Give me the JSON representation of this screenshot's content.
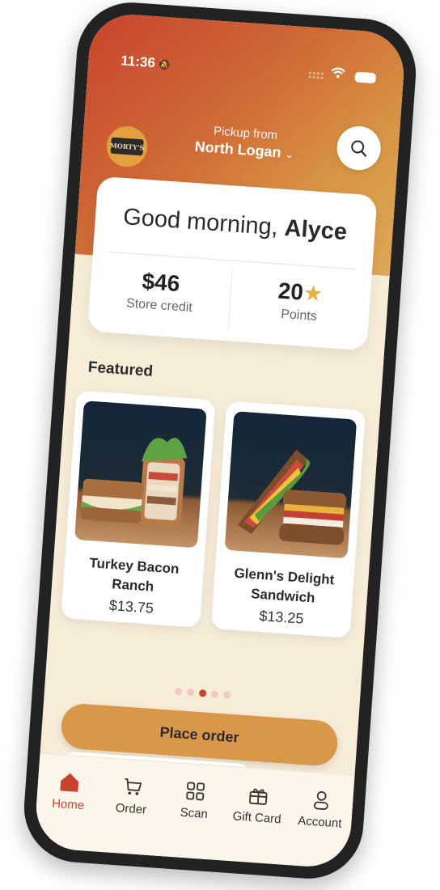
{
  "status_bar": {
    "time": "11:36",
    "bell_icon": "bell-slash-icon",
    "wifi_icon": "wifi-icon",
    "battery_icon": "battery-icon"
  },
  "header": {
    "logo_text": "MORTY'S",
    "pickup_label": "Pickup from",
    "pickup_location": "North Logan",
    "chevron": "⌄",
    "search_icon": "search-icon"
  },
  "greeting": {
    "prefix": "Good morning,",
    "name": "Alyce",
    "store_credit": {
      "value": "$46",
      "label": "Store credit"
    },
    "points": {
      "value": "20",
      "label": "Points",
      "icon": "star-icon"
    }
  },
  "featured": {
    "title": "Featured",
    "items": [
      {
        "name": "Turkey Bacon Ranch",
        "price": "$13.75"
      },
      {
        "name": "Glenn's Delight Sandwich",
        "price": "$13.25"
      }
    ],
    "carousel": {
      "total": 5,
      "active_index": 2
    }
  },
  "cta": {
    "label": "Place order"
  },
  "tabs": [
    {
      "label": "Home",
      "icon": "home-icon",
      "active": true
    },
    {
      "label": "Order",
      "icon": "cart-icon",
      "active": false
    },
    {
      "label": "Scan",
      "icon": "qr-code-icon",
      "active": false
    },
    {
      "label": "Gift Card",
      "icon": "gift-icon",
      "active": false
    },
    {
      "label": "Account",
      "icon": "user-icon",
      "active": false
    }
  ],
  "colors": {
    "accent": "#c7432e",
    "button": "#d9974a",
    "background": "#f7ecd8"
  }
}
